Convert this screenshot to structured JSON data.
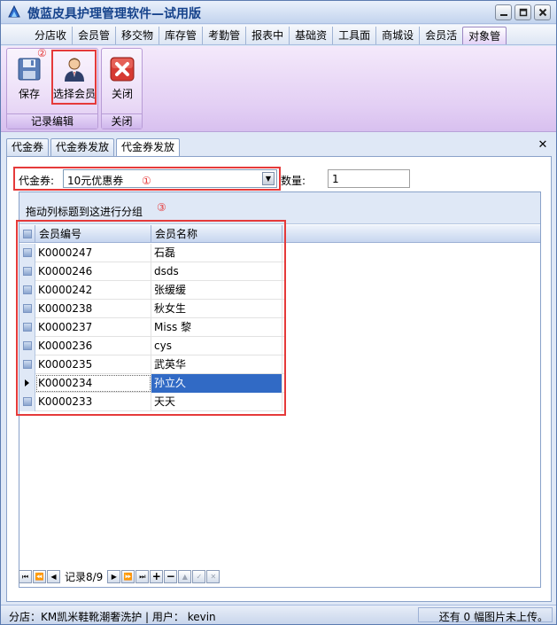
{
  "window": {
    "title": "傲蓝皮具护理管理软件—试用版",
    "controls": [
      "minimize",
      "restore",
      "close"
    ]
  },
  "menu": {
    "items": [
      "分店收",
      "会员管",
      "移交物",
      "库存管",
      "考勤管",
      "报表中",
      "基础资",
      "工具面",
      "商城设",
      "会员活",
      "对象管"
    ],
    "active_index": 10
  },
  "ribbon": {
    "groups": [
      {
        "label": "记录编辑",
        "buttons": [
          {
            "label": "保存",
            "icon": "floppy-disk-icon"
          },
          {
            "label": "选择会员",
            "icon": "member-person-icon",
            "marker": "②"
          }
        ]
      },
      {
        "label": "关闭",
        "buttons": [
          {
            "label": "关闭",
            "icon": "red-x-close-icon"
          }
        ]
      }
    ]
  },
  "doc_tabs": {
    "items": [
      "代金券",
      "代金券发放",
      "代金券发放"
    ],
    "active_index": 2
  },
  "form": {
    "coupon_label": "代金券:",
    "coupon_value": "10元优惠券",
    "coupon_marker": "①",
    "qty_label": "数量:",
    "qty_value": "1"
  },
  "grid": {
    "group_hint": "拖动列标题到这进行分组",
    "group_marker": "③",
    "columns": [
      "会员编号",
      "会员名称"
    ],
    "rows": [
      {
        "code": "K0000247",
        "name": "石磊"
      },
      {
        "code": "K0000246",
        "name": "dsds"
      },
      {
        "code": "K0000242",
        "name": "张缓缓"
      },
      {
        "code": "K0000238",
        "name": "秋女生"
      },
      {
        "code": "K0000237",
        "name": "Miss 黎"
      },
      {
        "code": "K0000236",
        "name": "cys"
      },
      {
        "code": "K0000235",
        "name": "武英华"
      },
      {
        "code": "K0000234",
        "name": "孙立久"
      },
      {
        "code": "K0000233",
        "name": "天天"
      }
    ],
    "selected_index": 7
  },
  "navigator": {
    "record_text": "记录8/9"
  },
  "status": {
    "left": "分店：KM凯米鞋靴潮奢洗护  | 用户： kevin",
    "right": "还有 0 幅图片未上传。"
  },
  "colors": {
    "highlight": "#316ac5",
    "annotation_red": "#e53a3a",
    "title_text": "#15428b"
  }
}
